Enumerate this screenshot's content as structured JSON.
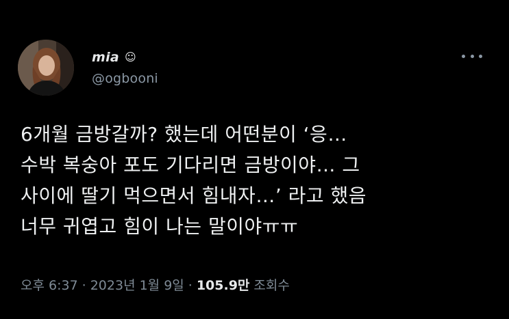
{
  "tweet": {
    "display_name": "mia",
    "name_emoji": "☺",
    "handle": "@ogbooni",
    "text_lines": [
      "6개월 금방갈까? 했는데 어떤분이 ‘응…",
      "수박 복숭아 포도 기다리면 금방이야… 그",
      "사이에 딸기 먹으면서 힘내자…’ 라고 했음",
      "너무 귀엽고 힘이 나는 말이야ㅠㅠ"
    ],
    "time": "오후 6:37",
    "date": "2023년 1월 9일",
    "separator": "·",
    "views_count": "105.9만",
    "views_label": "조회수"
  },
  "icons": {
    "more": "more-horizontal-icon",
    "avatar": "profile-photo"
  },
  "colors": {
    "background": "#000000",
    "primary_text": "#e7e9ea",
    "secondary_text": "#8b98a5"
  }
}
